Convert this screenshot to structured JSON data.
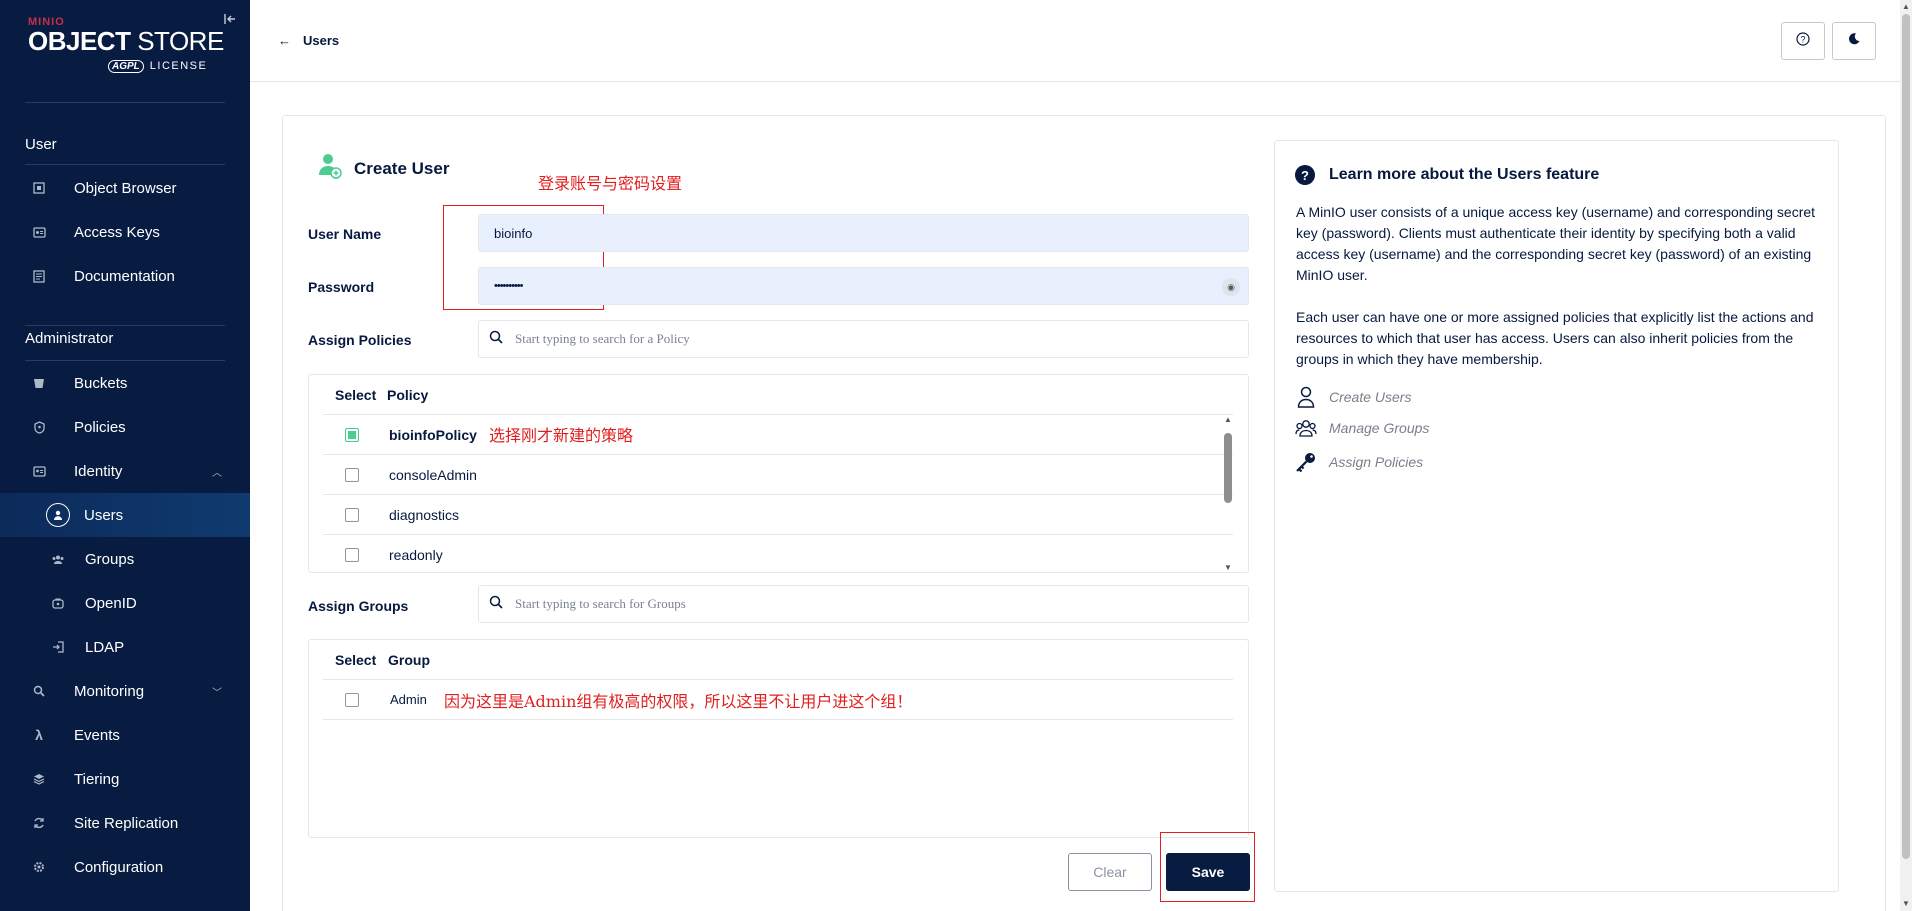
{
  "sidebar": {
    "logo": {
      "brand": "MINIO",
      "product_bold": "OBJECT",
      "product_light": "STORE",
      "license_badge": "AGPL",
      "license": "LICENSE"
    },
    "sections": [
      {
        "title": "User"
      },
      {
        "title": "Administrator"
      }
    ],
    "items": [
      {
        "label": "Object Browser",
        "icon": "object-browser-icon"
      },
      {
        "label": "Access Keys",
        "icon": "access-keys-icon"
      },
      {
        "label": "Documentation",
        "icon": "documentation-icon"
      },
      {
        "label": "Buckets",
        "icon": "buckets-icon"
      },
      {
        "label": "Policies",
        "icon": "policies-icon"
      },
      {
        "label": "Identity",
        "icon": "identity-icon"
      },
      {
        "label": "Users",
        "icon": "user-icon"
      },
      {
        "label": "Groups",
        "icon": "groups-icon"
      },
      {
        "label": "OpenID",
        "icon": "openid-icon"
      },
      {
        "label": "LDAP",
        "icon": "ldap-icon"
      },
      {
        "label": "Monitoring",
        "icon": "monitoring-icon"
      },
      {
        "label": "Events",
        "icon": "lambda-icon"
      },
      {
        "label": "Tiering",
        "icon": "tiering-icon"
      },
      {
        "label": "Site Replication",
        "icon": "replication-icon"
      },
      {
        "label": "Configuration",
        "icon": "gear-icon"
      }
    ]
  },
  "header": {
    "back_label": "Users"
  },
  "form": {
    "title": "Create User",
    "username_label": "User Name",
    "username_value": "bioinfo",
    "password_label": "Password",
    "password_value": "••••••••••",
    "policies_label": "Assign Policies",
    "policies_placeholder": "Start typing to search for a Policy",
    "policy_table": {
      "headers": [
        "Select",
        "Policy"
      ],
      "rows": [
        {
          "name": "bioinfoPolicy",
          "checked": true
        },
        {
          "name": "consoleAdmin",
          "checked": false
        },
        {
          "name": "diagnostics",
          "checked": false
        },
        {
          "name": "readonly",
          "checked": false
        }
      ]
    },
    "groups_label": "Assign Groups",
    "groups_placeholder": "Start typing to search for Groups",
    "group_table": {
      "headers": [
        "Select",
        "Group"
      ],
      "rows": [
        {
          "name": "Admin",
          "checked": false
        }
      ]
    },
    "clear_label": "Clear",
    "save_label": "Save"
  },
  "annotations": {
    "credentials": "登录账号与密码设置",
    "policy": "选择刚才新建的策略",
    "group": "因为这里是Admin组有极高的权限，所以这里不让用户进这个组！",
    "color": "#e02020"
  },
  "help": {
    "title": "Learn more about the Users feature",
    "paragraph1": "A MinIO user consists of a unique access key (username) and corresponding secret key (password). Clients must authenticate their identity by specifying both a valid access key (username) and the corresponding secret key (password) of an existing MinIO user.",
    "paragraph2": "Each user can have one or more assigned policies that explicitly list the actions and resources to which that user has access. Users can also inherit policies from the groups in which they have membership.",
    "links": [
      {
        "label": "Create Users",
        "icon": "user-outline-icon"
      },
      {
        "label": "Manage Groups",
        "icon": "groups-outline-icon"
      },
      {
        "label": "Assign Policies",
        "icon": "key-icon"
      }
    ]
  },
  "colors": {
    "sidebar_bg": "#081C42",
    "primary": "#081C42",
    "checkbox_checked": "#4CCB92",
    "input_filled_bg": "#E8F0FE"
  }
}
